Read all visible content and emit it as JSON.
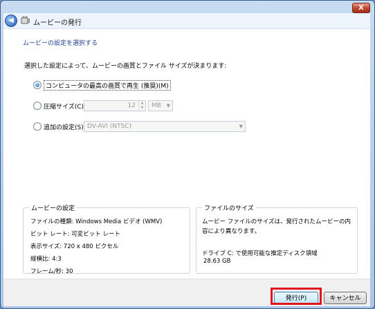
{
  "window": {
    "title": "ムービーの発行",
    "close_label": "X"
  },
  "main_instruction": "ムービーの設定を選択する",
  "intro": "選択した設定によって、ムービーの画質とファイル サイズが決まります:",
  "options": {
    "best_quality": {
      "label": "コンピュータの最高の画質で再生 (推奨)(M)",
      "selected": true
    },
    "compressed": {
      "label": "圧縮サイズ(C):",
      "value": "12",
      "unit": "MB"
    },
    "other": {
      "label": "追加の設定(S):",
      "value": "DV-AVI (NTSC)"
    }
  },
  "movie_settings": {
    "title": "ムービーの設定",
    "lines": [
      "ファイルの種類: Windows Media ビデオ (WMV)",
      "ビット レート: 可変ビット レート",
      "表示サイズ: 720 x 480 ピクセル",
      "縦横比: 4:3",
      "フレーム/秒: 30"
    ]
  },
  "file_size": {
    "title": "ファイルのサイズ",
    "description": "ムービー ファイルのサイズは、発行されたムービーの内容により異なります。",
    "drive_label": "ドライブ C: で使用可能な推定ディスク領域",
    "drive_free": "28.63 GB"
  },
  "buttons": {
    "publish": "発行(P)",
    "cancel": "キャンセル"
  },
  "colors": {
    "highlight": "#e4141d",
    "instruction": "#1f3f96"
  }
}
